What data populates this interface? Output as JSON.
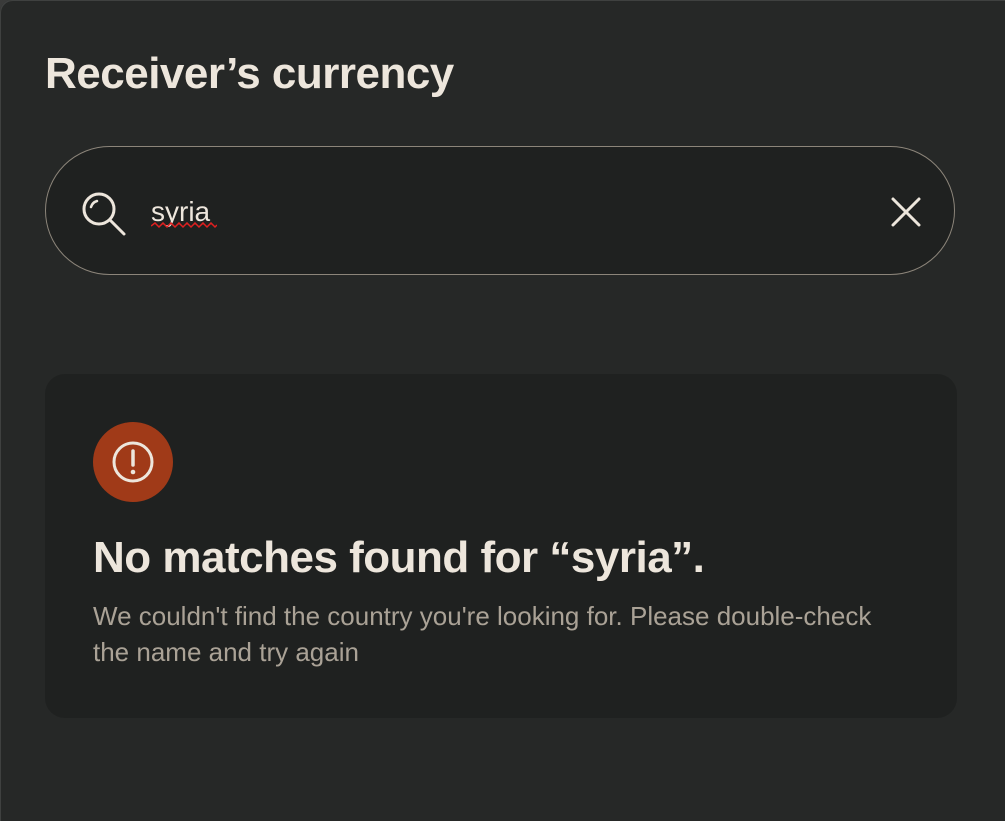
{
  "header": {
    "title": "Receiver’s currency"
  },
  "search": {
    "value": "syria",
    "icon": "search-icon",
    "clear_icon": "close-icon"
  },
  "empty_state": {
    "icon": "alert-circle-icon",
    "headline": "No matches found for “syria”.",
    "message": "We couldn't find the country you're looking for. Please double-check the name and try again"
  },
  "colors": {
    "background": "#262827",
    "card": "#1f2120",
    "text_primary": "#ede6dc",
    "text_secondary": "#aaa296",
    "border": "#8c857a",
    "alert": "#a03a18",
    "spellcheck": "#e02020"
  }
}
